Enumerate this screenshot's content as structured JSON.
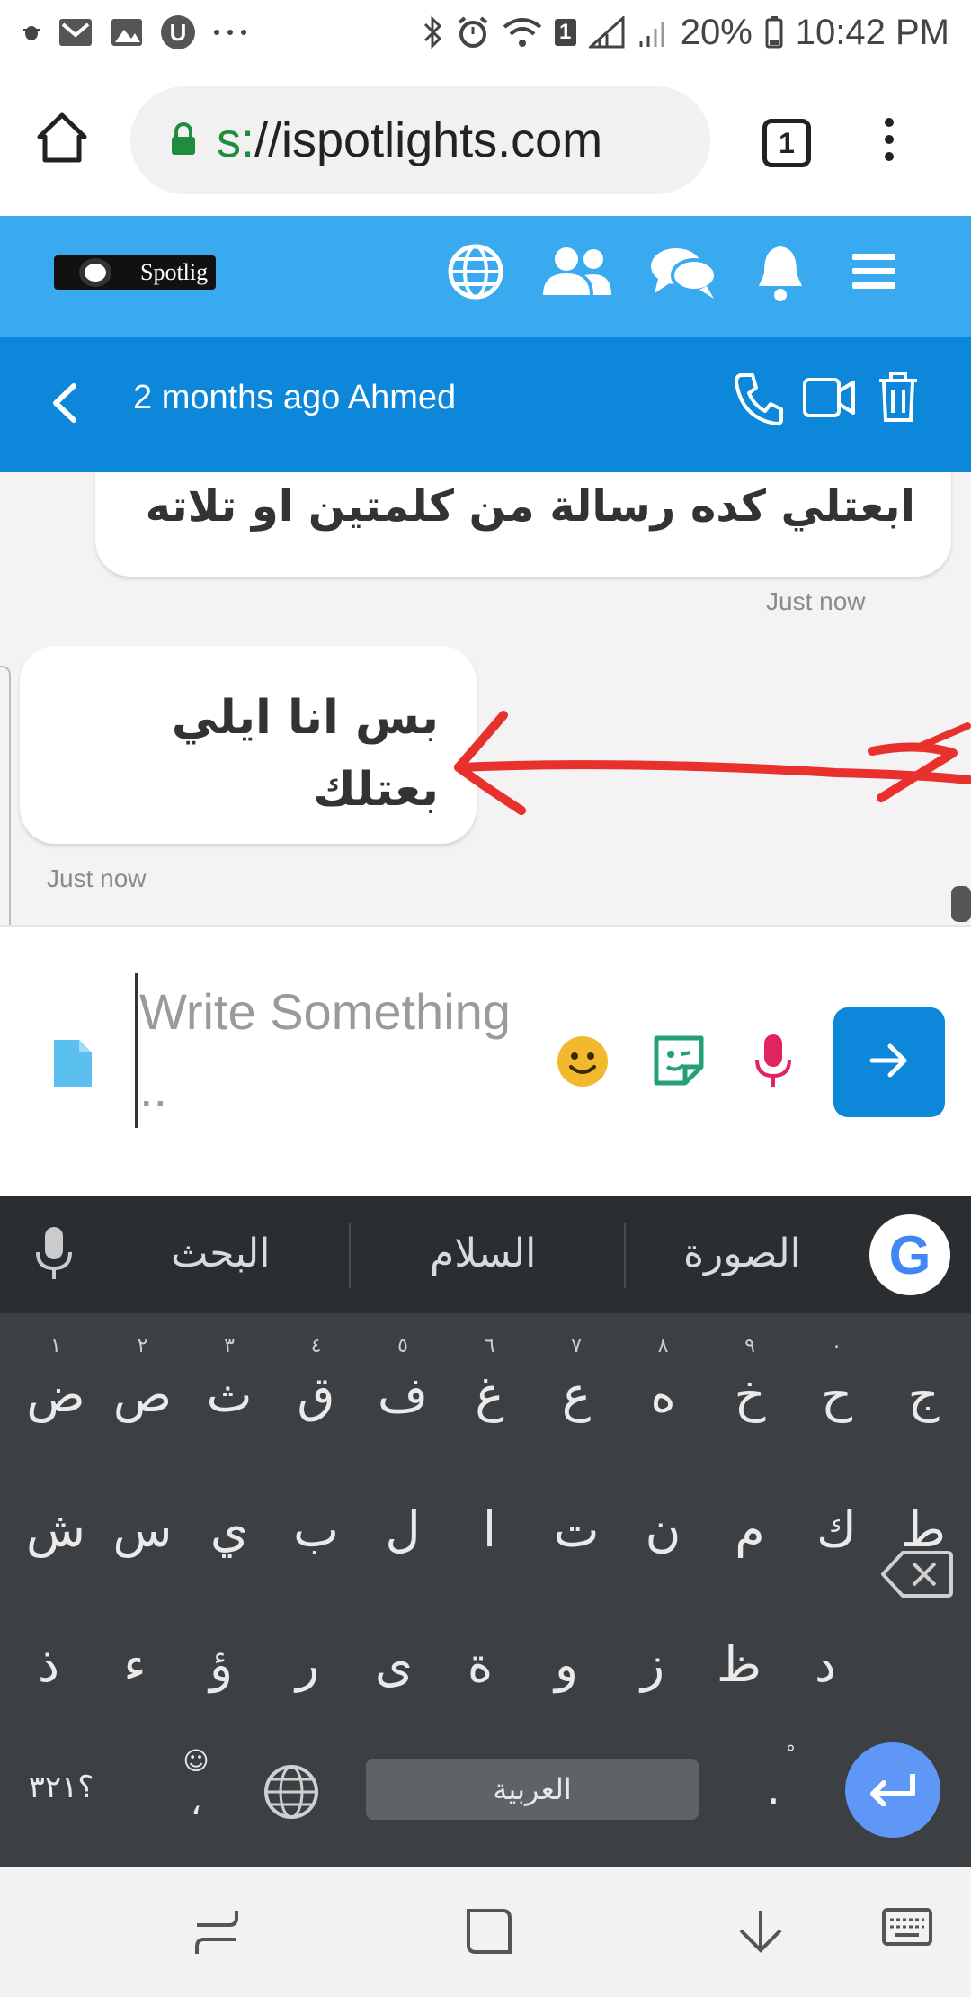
{
  "status_bar": {
    "battery": "20%",
    "time": "10:42 PM",
    "sim_badge": "1",
    "notification_icons": [
      "bug-icon",
      "gmail-icon",
      "gallery-icon",
      "u-app-icon",
      "more-dots-icon"
    ]
  },
  "browser": {
    "url_prefix": "s:",
    "url_main": "//ispotlights.com",
    "tab_count": "1"
  },
  "site": {
    "logo_text": "Spotlig"
  },
  "chat": {
    "title": "2 months ago Ahmed",
    "messages": [
      {
        "text": "ابعتلي كده رسالة من كلمتين او تلاته",
        "time": "Just now"
      },
      {
        "text_line1": "بس انا ايلي",
        "text_line2": "بعتلك",
        "time": "Just now"
      }
    ]
  },
  "composer": {
    "placeholder": "Write Something .."
  },
  "keyboard": {
    "suggestions": [
      "البحث",
      "السلام",
      "الصورة"
    ],
    "row1": [
      "ض",
      "ص",
      "ث",
      "ق",
      "ف",
      "غ",
      "ع",
      "ه",
      "خ",
      "ح",
      "ج"
    ],
    "row1_hints": [
      "١",
      "٢",
      "٣",
      "٤",
      "٥",
      "٦",
      "٧",
      "٨",
      "٩",
      "٠",
      ""
    ],
    "row2": [
      "ش",
      "س",
      "ي",
      "ب",
      "ل",
      "ا",
      "ت",
      "ن",
      "م",
      "ك",
      "ط"
    ],
    "row3": [
      "ذ",
      "ء",
      "ؤ",
      "ر",
      "ى",
      "ة",
      "و",
      "ز",
      "ظ",
      "د"
    ],
    "symbols_key": "؟٣٢١",
    "comma_key": "،",
    "space_label": "العربية",
    "period_key": "."
  },
  "colors": {
    "site_header": "#3aaaf0",
    "chat_header": "#0d87d9",
    "send_button": "#0d87d9",
    "mic": "#e0245e",
    "emoji": "#f2b92e",
    "sticker": "#23a07a",
    "file": "#5bc0f0",
    "annotation_arrow": "#e8302c"
  }
}
